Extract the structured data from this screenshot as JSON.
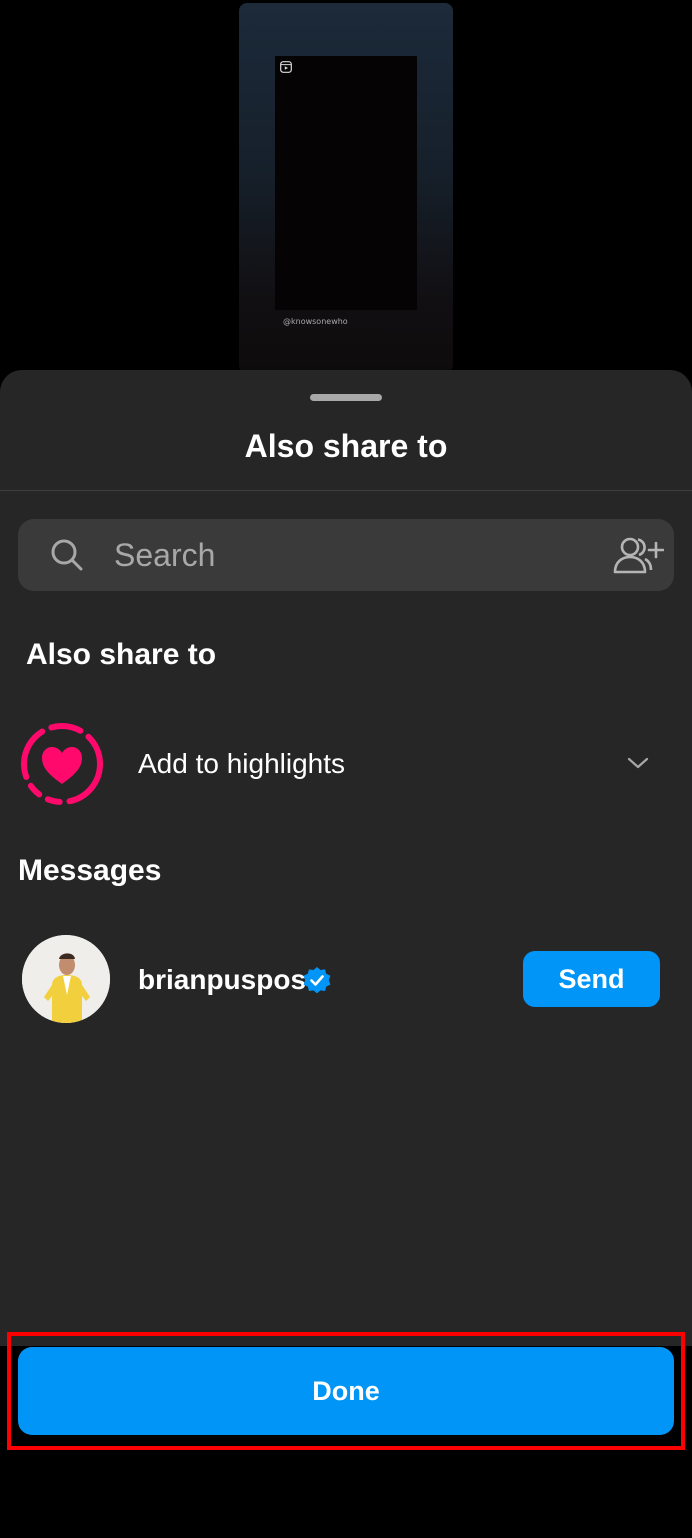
{
  "preview": {
    "handle": "@knowsonewho"
  },
  "sheet": {
    "title": "Also share to"
  },
  "search": {
    "placeholder": "Search"
  },
  "share_section": {
    "title": "Also share to",
    "highlights_label": "Add to highlights"
  },
  "messages_section": {
    "title": "Messages",
    "contacts": [
      {
        "username": "brianpuspos",
        "verified": true,
        "action_label": "Send"
      }
    ]
  },
  "footer": {
    "done_label": "Done"
  },
  "colors": {
    "accent": "#0095f6",
    "highlight_pink": "#ff0a6c",
    "sheet_bg": "#262626",
    "search_bg": "#3a3a3a"
  }
}
